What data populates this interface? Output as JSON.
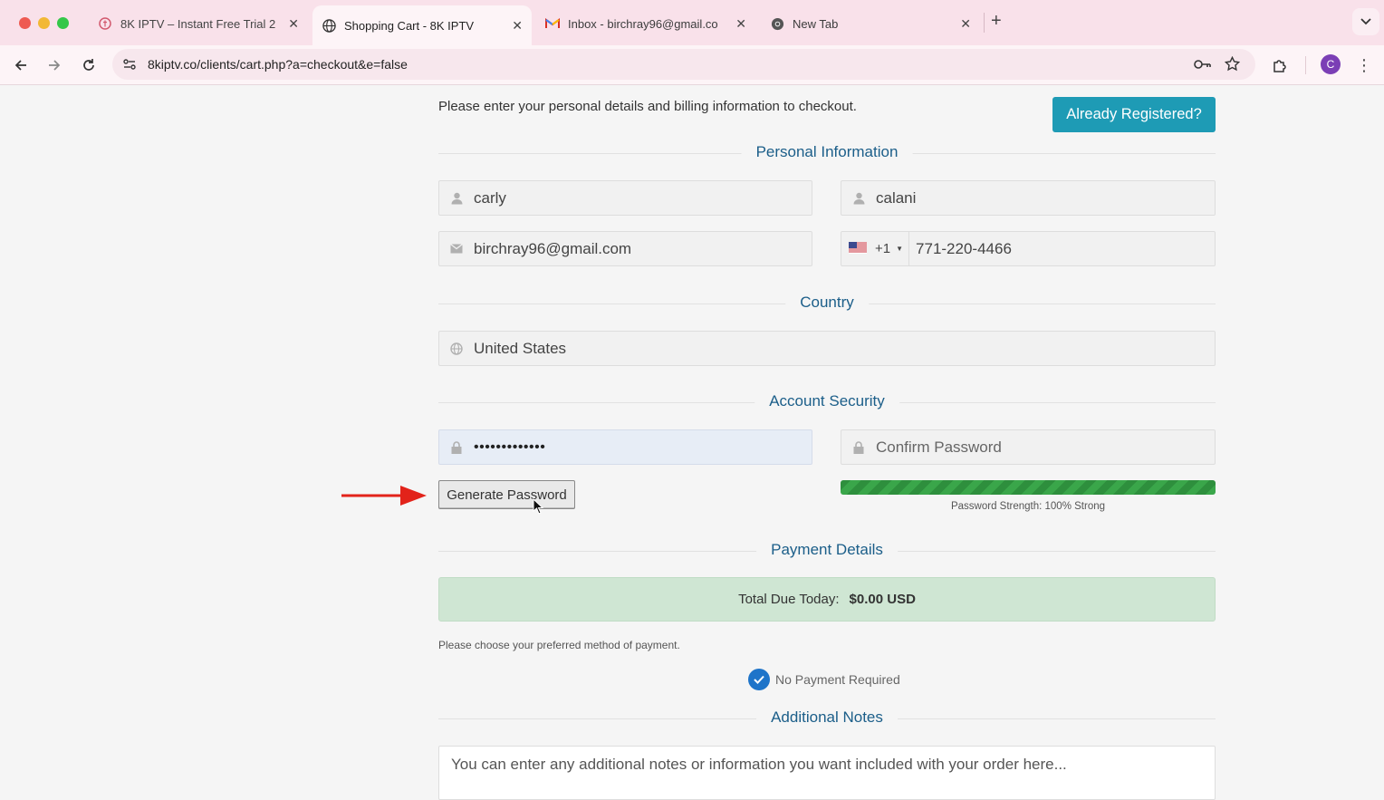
{
  "browser": {
    "tabs": [
      {
        "label": "8K IPTV – Instant Free Trial 2",
        "icon": "pinterest-like-icon"
      },
      {
        "label": "Shopping Cart - 8K IPTV",
        "icon": "globe-icon"
      },
      {
        "label": "Inbox - birchray96@gmail.co",
        "icon": "gmail-icon"
      },
      {
        "label": "New Tab",
        "icon": "chrome-icon"
      }
    ],
    "url": "8kiptv.co/clients/cart.php?a=checkout&e=false",
    "profile_initial": "C"
  },
  "checkout": {
    "intro": "Please enter your personal details and billing information to checkout.",
    "already_registered": "Already Registered?",
    "sections": {
      "personal": "Personal Information",
      "country": "Country",
      "security": "Account Security",
      "payment": "Payment Details",
      "notes": "Additional Notes"
    },
    "first_name": "carly",
    "last_name": "calani",
    "email": "birchray96@gmail.com",
    "phone_code": "+1",
    "phone": "771-220-4466",
    "country": "United States",
    "password_mask": "•••••••••••••",
    "confirm_password_placeholder": "Confirm Password",
    "generate_password": "Generate Password",
    "strength_label": "Password Strength: 100% Strong",
    "strength_percent": 100,
    "total_label": "Total Due Today:",
    "total_value": "$0.00 USD",
    "payment_note": "Please choose your preferred method of payment.",
    "no_payment": "No Payment Required",
    "notes_placeholder": "You can enter any additional notes or information you want included with your order here..."
  },
  "colors": {
    "accent": "#1e9bb5",
    "section_title": "#1b5e89",
    "strength": "#3aa64a",
    "total_bg": "#cfe6d3",
    "arrow": "#e2231a"
  }
}
